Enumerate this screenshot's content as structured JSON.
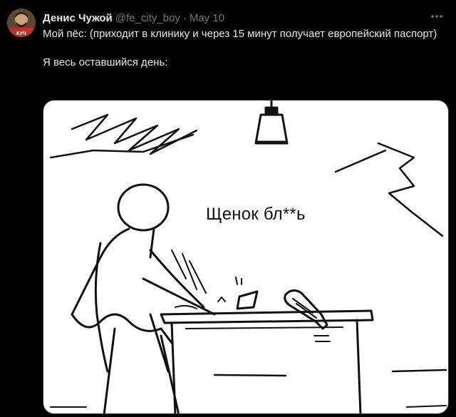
{
  "tweet": {
    "author_name": "Денис Чужой",
    "author_handle": "@fe_city_boy",
    "separator": "·",
    "date": "May 10",
    "text_line1": "Мой пёс: (приходит в клинику и через 15 минут получает европейский паспорт)",
    "text_line2": "Я весь оставшийся день:",
    "avatar_label": "КУЧ"
  },
  "media": {
    "caption": "Щенок бл**ь"
  },
  "icons": {
    "more": "more-horizontal-icon"
  }
}
